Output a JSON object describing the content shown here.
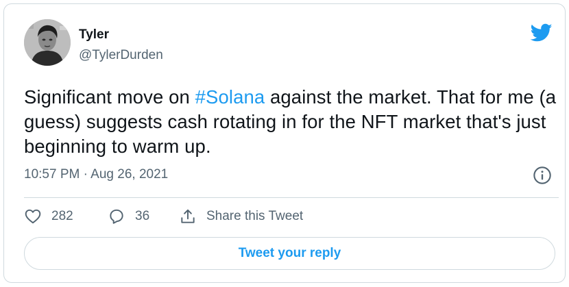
{
  "author": {
    "display_name": "Tyler",
    "handle": "@TylerDurden"
  },
  "tweet": {
    "text_before": "Significant move on ",
    "hashtag": "#Solana",
    "text_after": " against the market. That for me (a guess) suggests cash rotating in for the NFT market that's just beginning to warm up.",
    "timestamp": "10:57 PM · Aug 26, 2021"
  },
  "actions": {
    "likes": "282",
    "replies": "36",
    "share_label": "Share this Tweet"
  },
  "reply_button_label": "Tweet your reply",
  "colors": {
    "accent": "#1d9bf0",
    "text": "#0f1419",
    "secondary": "#536471",
    "border": "#cfd9de"
  },
  "icons": [
    "twitter-bird-icon",
    "info-icon",
    "heart-icon",
    "reply-bubble-icon",
    "share-icon"
  ]
}
